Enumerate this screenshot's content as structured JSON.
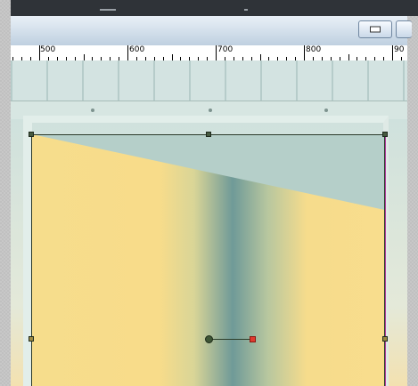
{
  "window": {
    "minimize_icon": "minimize-icon"
  },
  "ruler": {
    "unit": "px",
    "labels": [
      "500",
      "600",
      "700",
      "800",
      "90"
    ]
  },
  "canvas": {
    "layer": "linear-gradient",
    "colors": {
      "yellow": "#f8dc8a",
      "teal": "#6f9a98",
      "handle": "#465a40",
      "gradient_end": "#e03a2e"
    }
  }
}
